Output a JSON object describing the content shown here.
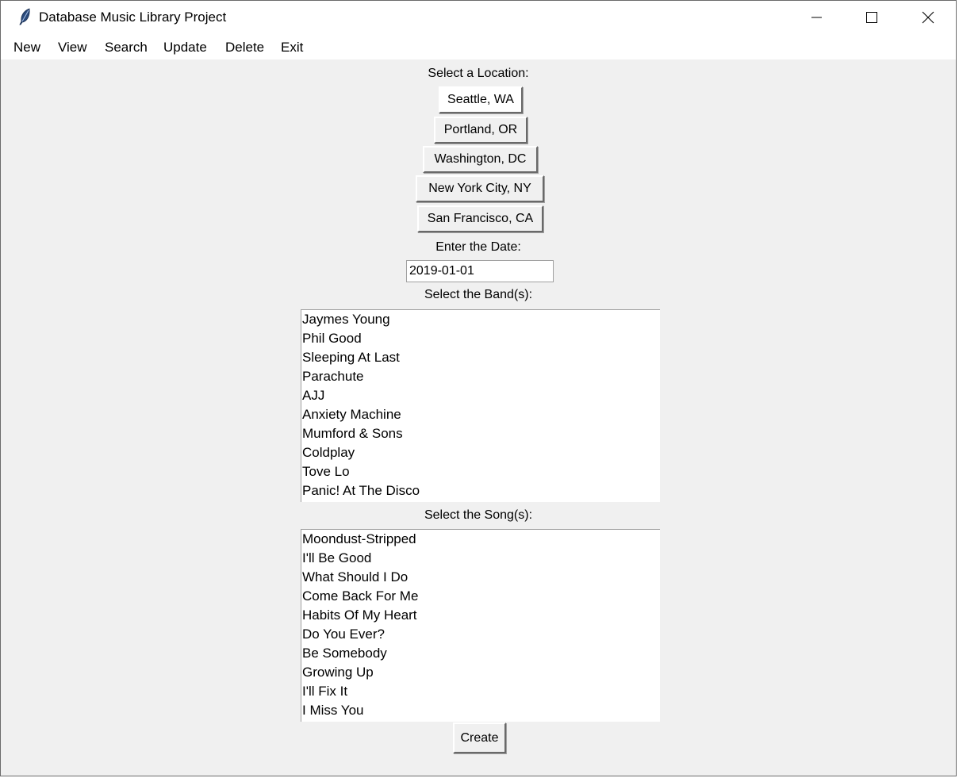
{
  "window": {
    "title": "Database Music Library Project"
  },
  "menu": {
    "items": [
      "New",
      "View",
      "Search",
      "Update",
      "Delete",
      "Exit"
    ]
  },
  "location": {
    "label": "Select a Location:",
    "options": [
      "Seattle, WA",
      "Portland, OR",
      "Washington, DC",
      "New York City, NY",
      "San Francisco, CA"
    ],
    "selected": "Seattle, WA"
  },
  "date": {
    "label": "Enter the Date:",
    "value": "2019-01-01"
  },
  "bands": {
    "label": "Select the Band(s):",
    "items": [
      "Jaymes Young",
      "Phil Good",
      "Sleeping At Last",
      "Parachute",
      "AJJ",
      "Anxiety Machine",
      "Mumford & Sons",
      "Coldplay",
      "Tove Lo",
      "Panic! At The Disco"
    ]
  },
  "songs": {
    "label": "Select the Song(s):",
    "items": [
      "Moondust-Stripped",
      "I'll Be Good",
      "What Should I Do",
      "Come Back For Me",
      "Habits Of My Heart",
      "Do You Ever?",
      "Be Somebody",
      "Growing Up",
      "I'll Fix It",
      "I Miss You"
    ]
  },
  "actions": {
    "create_label": "Create"
  }
}
